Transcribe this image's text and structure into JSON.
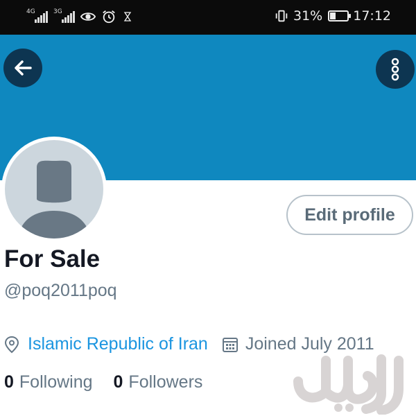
{
  "status_bar": {
    "network_1": "4G",
    "network_2": "3G",
    "icons": [
      "signal-4g-icon",
      "signal-3g-icon",
      "eye-icon",
      "alarm-icon",
      "hourglass-icon",
      "vibrate-icon",
      "battery-icon"
    ],
    "battery_percent": "31%",
    "battery_level": 0.31,
    "time": "17:12"
  },
  "header": {
    "banner_color": "#0f88bf",
    "back_icon": "arrow-left-icon",
    "more_icon": "more-vertical-icon"
  },
  "profile": {
    "edit_button_label": "Edit profile",
    "display_name": "For Sale",
    "handle": "@poq2011poq",
    "location": "Islamic Republic of Iran",
    "joined": "Joined July 2011",
    "following_count": "0",
    "following_label": "Following",
    "followers_count": "0",
    "followers_label": "Followers"
  },
  "colors": {
    "accent": "#1b95e0",
    "banner": "#0f88bf",
    "muted_text": "#657786",
    "primary_text": "#141823"
  },
  "watermark": {
    "text": "دیوار"
  }
}
